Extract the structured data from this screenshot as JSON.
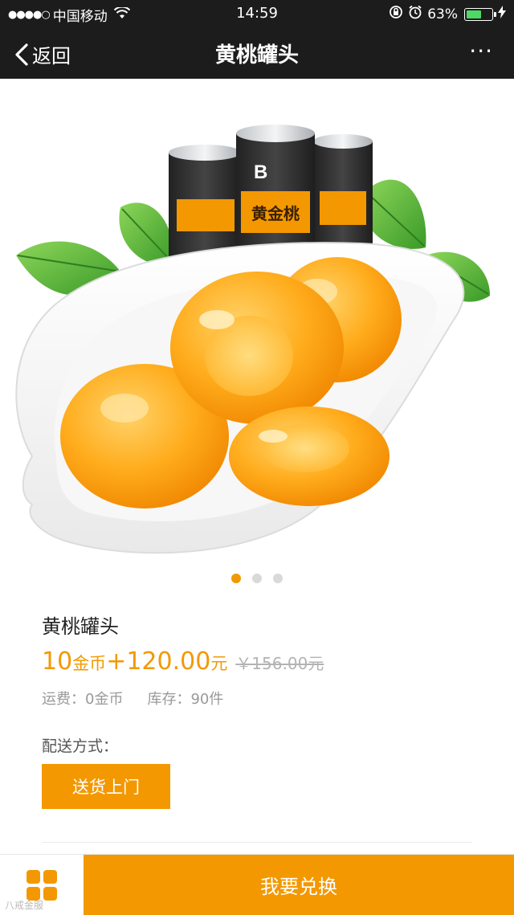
{
  "status_bar": {
    "signal": "●●●●○",
    "carrier": "中国移动",
    "time": "14:59",
    "battery": "63%",
    "battery_level": 0.63
  },
  "nav": {
    "back_label": "返回",
    "title": "黄桃罐头",
    "more_icon": "···"
  },
  "hero": {
    "can_label": "黄金桃",
    "can_brand": "B"
  },
  "carousel": {
    "count": 3,
    "active": 0
  },
  "product": {
    "name": "黄桃罐头",
    "coins_value": "10",
    "coins_unit": "金币",
    "plus": "+",
    "cash_value": "120.00",
    "cash_unit": "元",
    "original_price": "￥156.00元",
    "shipping": "运费：0金币",
    "stock": "库存：90件"
  },
  "delivery": {
    "label": "配送方式：",
    "option": "送货上门"
  },
  "bottom": {
    "exchange_label": "我要兑换",
    "watermark": "八戒金服"
  },
  "colors": {
    "accent": "#f39800",
    "topbar": "#1c1c1c",
    "battery": "#4cd964"
  }
}
